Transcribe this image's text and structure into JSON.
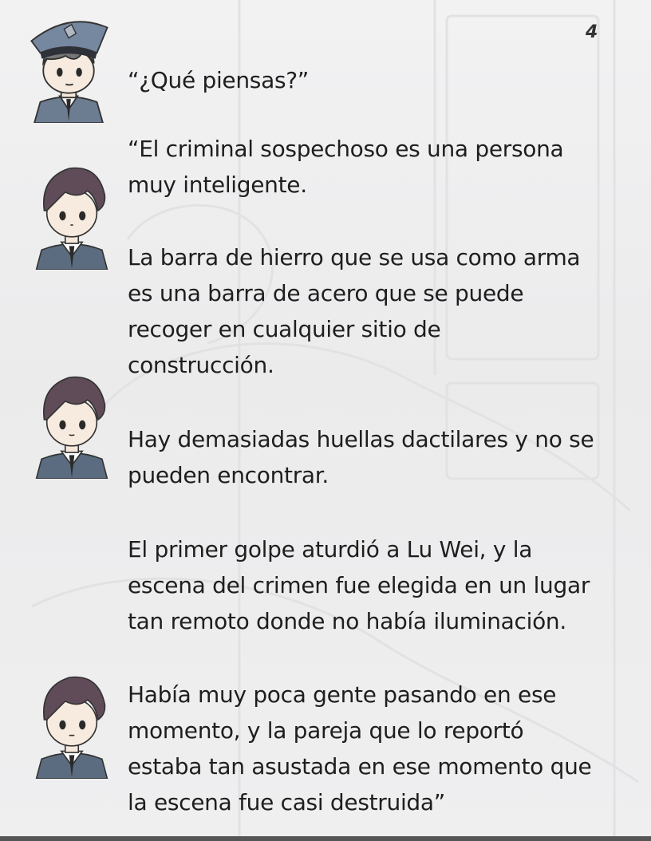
{
  "page_number": "4",
  "dialogue": [
    {
      "speaker": "police-officer",
      "text": "“¿Qué piensas?”"
    },
    {
      "speaker": "detective",
      "text": "“El criminal sospechoso es una persona\nmuy inteligente."
    },
    {
      "speaker": "detective",
      "text": "La barra de hierro que se usa como arma\nes una barra de acero que se puede\nrecoger en cualquier sitio de\nconstrucción."
    },
    {
      "speaker": "detective",
      "text": "Hay demasiadas huellas dactilares y no se\npueden encontrar."
    },
    {
      "speaker": "none",
      "text": "El primer golpe aturdió a Lu Wei, y la\nescena del crimen fue elegida en un lugar\ntan remoto donde no había iluminación."
    },
    {
      "speaker": "detective",
      "text": "Había muy poca gente pasando en ese\nmomento, y la pareja que lo reportó\nestaba tan asustada en ese momento que\nla escena fue casi destruida”"
    }
  ],
  "colors": {
    "background": "#efeff0",
    "text": "#1e1e1e",
    "uniform": "#5b6c80",
    "hair": "#5f4c58",
    "cap": "#6f7f93"
  }
}
